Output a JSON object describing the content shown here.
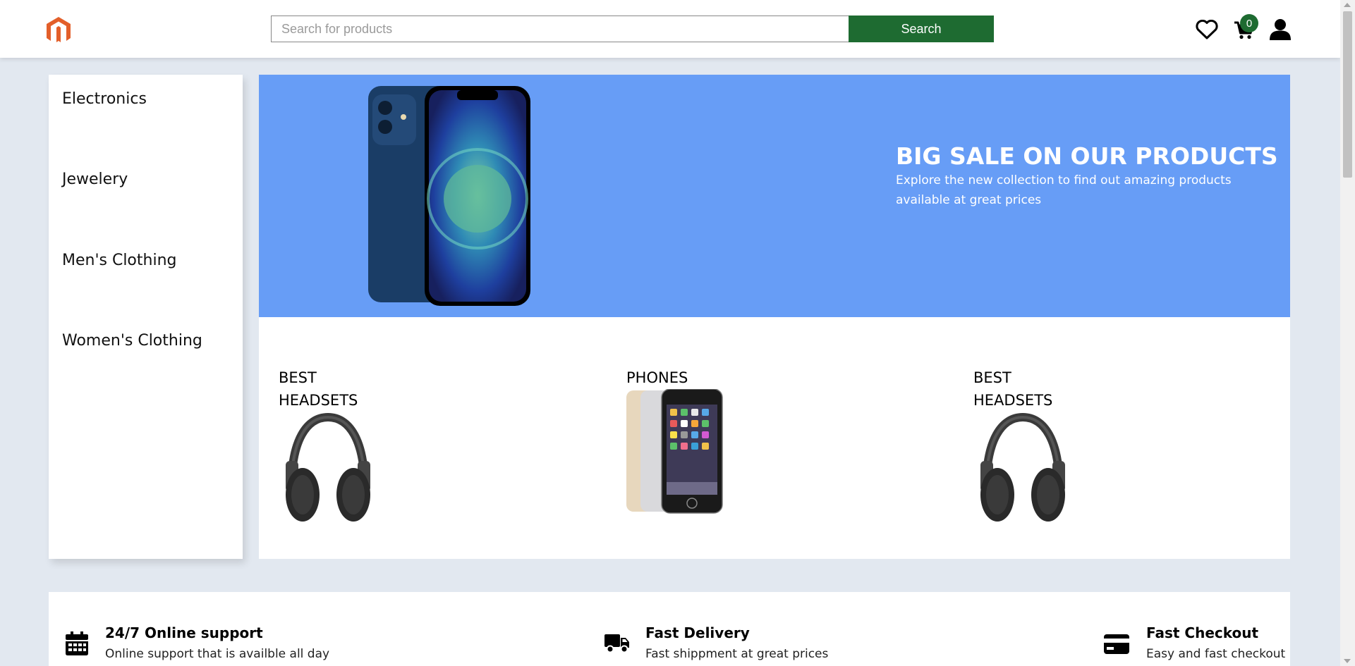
{
  "header": {
    "logo": "magento-logo-icon",
    "search": {
      "placeholder": "Search for products",
      "value": "",
      "button_label": "Search"
    },
    "cart_count": "0",
    "icons": [
      "heart-icon",
      "cart-icon",
      "user-icon"
    ]
  },
  "sidebar": {
    "categories": [
      {
        "label": "Electronics"
      },
      {
        "label": "Jewelery"
      },
      {
        "label": "Men's Clothing"
      },
      {
        "label": "Women's Clothing"
      }
    ]
  },
  "hero": {
    "title": "BIG SALE ON OUR PRODUCTS",
    "subtitle": "Explore the new collection to find out amazing products available at great prices"
  },
  "promo_cards": [
    {
      "title_line1": "BEST",
      "title_line2": "HEADSETS"
    },
    {
      "title_line1": "PHONES",
      "title_line2": ""
    },
    {
      "title_line1": "BEST",
      "title_line2": "HEADSETS"
    }
  ],
  "features": [
    {
      "icon": "calendar-icon",
      "title": "24/7 Online support",
      "description": "Online support that is availble all day"
    },
    {
      "icon": "truck-icon",
      "title": "Fast Delivery",
      "description": "Fast shippment at great prices"
    },
    {
      "icon": "credit-card-icon",
      "title": "Fast Checkout",
      "description": "Easy and fast checkout"
    }
  ],
  "colors": {
    "accent_green": "#1e6b31",
    "hero_blue": "#679df6",
    "logo_orange": "#e35f2a",
    "page_bg": "#e2e8f0"
  }
}
